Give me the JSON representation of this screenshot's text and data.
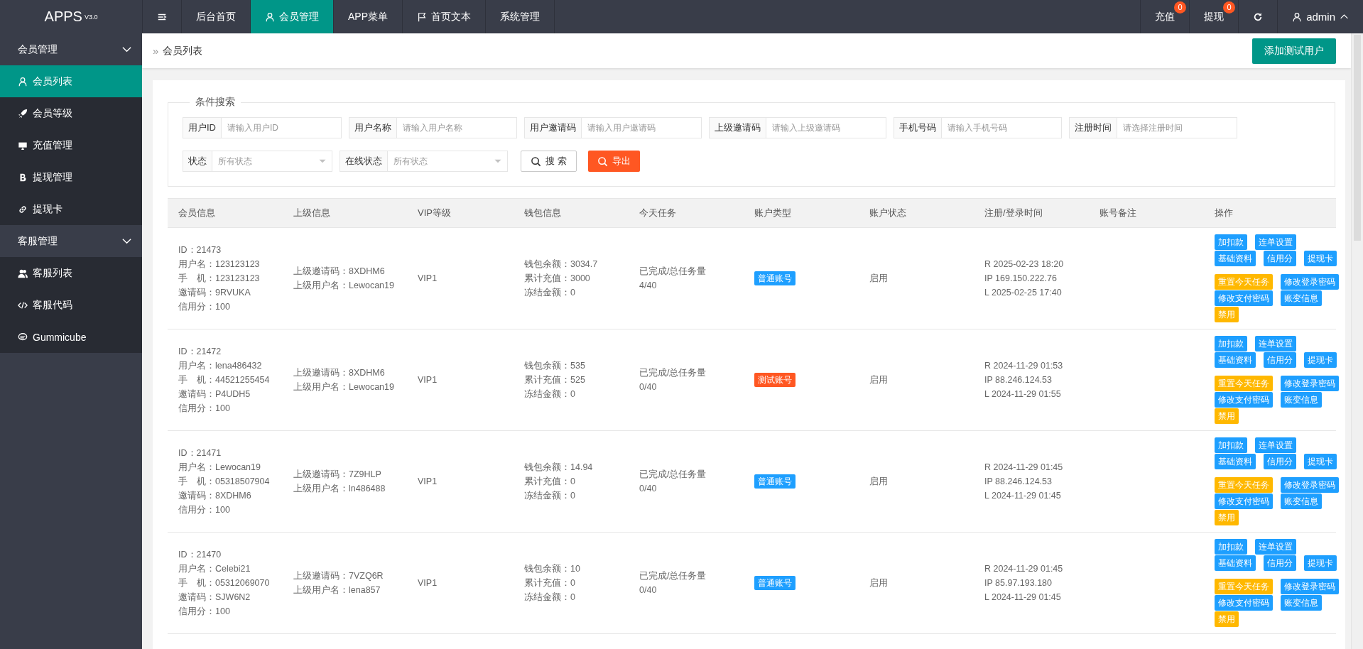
{
  "header": {
    "logo": "APPS$^{V3.0}$",
    "nav": [
      {
        "kind": "menu",
        "selected": false
      },
      {
        "kind": "text",
        "label": "后台首页",
        "selected": false
      },
      {
        "kind": "user",
        "label": "会员管理",
        "selected": true
      },
      {
        "kind": "text",
        "label": "APP菜单",
        "selected": false
      },
      {
        "kind": "flag",
        "label": "首页文本",
        "selected": false
      },
      {
        "kind": "text",
        "label": "系统管理",
        "selected": false
      }
    ],
    "tools": [
      {
        "kind": "text",
        "label": "充值",
        "badge": "0"
      },
      {
        "kind": "text",
        "label": "提现",
        "badge": "0"
      },
      {
        "kind": "refresh"
      },
      {
        "kind": "user",
        "label": "admin"
      }
    ]
  },
  "sidebar": {
    "groups": [
      {
        "label": "会员管理",
        "expanded": true,
        "items": [
          {
            "kind": "user",
            "label": "会员列表",
            "selected": true
          },
          {
            "kind": "rocket",
            "label": "会员等级",
            "selected": false
          },
          {
            "kind": "monitor",
            "label": "充值管理",
            "selected": false
          },
          {
            "kind": "coin",
            "label": "提现管理",
            "selected": false
          },
          {
            "kind": "link",
            "label": "提现卡",
            "selected": false
          }
        ]
      },
      {
        "label": "客服管理",
        "expanded": true,
        "items": [
          {
            "kind": "users",
            "label": "客服列表",
            "selected": false
          },
          {
            "kind": "code",
            "label": "客服代码",
            "selected": false
          },
          {
            "kind": "chat",
            "label": "Gummicube",
            "selected": false
          }
        ]
      }
    ]
  },
  "breadcrumb": {
    "separator": "»",
    "items": [
      "会员列表"
    ]
  },
  "add_button": "添加测试用户",
  "search": {
    "legend": "条件搜索",
    "fields": [
      {
        "kind": "input",
        "label": "用户ID",
        "placeholder": "请输入用户ID"
      },
      {
        "kind": "input",
        "label": "用户名称",
        "placeholder": "请输入用户名称"
      },
      {
        "kind": "input",
        "label": "用户邀请码",
        "placeholder": "请输入用户邀请码"
      },
      {
        "kind": "input",
        "label": "上级邀请码",
        "placeholder": "请输入上级邀请码"
      },
      {
        "kind": "input",
        "label": "手机号码",
        "placeholder": "请输入手机号码"
      },
      {
        "kind": "input",
        "label": "注册时间",
        "placeholder": "请选择注册时间"
      },
      {
        "kind": "select",
        "label": "状态",
        "placeholder": "所有状态"
      },
      {
        "kind": "select",
        "label": "在线状态",
        "placeholder": "所有状态"
      }
    ],
    "buttons": [
      {
        "kind": "plain",
        "label": "搜 索"
      },
      {
        "kind": "danger",
        "label": "导出"
      }
    ]
  },
  "table": {
    "columns": [
      "会员信息",
      "上级信息",
      "VIP等级",
      "钱包信息",
      "今天任务",
      "账户类型",
      "账户状态",
      "注册/登录时间",
      "账号备注",
      "操作"
    ],
    "rows": [
      {
        "member": [
          "ID：21473",
          "用户名：123123123",
          "手　机：123123123",
          "邀请码：9RVUKA",
          "信用分：100"
        ],
        "parent": [
          "上级邀请码：8XDHM6",
          "上级用户名：Lewocan19"
        ],
        "vip": "VIP1",
        "wallet": [
          "钱包余额：3034.7",
          "累计充值：3000",
          "冻结金额：0"
        ],
        "task": [
          "已完成/总任务量",
          "4/40"
        ],
        "account_type": {
          "label": "普通账号",
          "color": "#1e9fff"
        },
        "status": "启用",
        "times": [
          "R 2025-02-23 18:20",
          "IP 169.150.222.76",
          "L 2025-02-25 17:40"
        ],
        "actions": [
          [
            {
              "label": "加扣款",
              "color": "#1e9fff"
            },
            {
              "label": "连单设置",
              "color": "#1e9fff"
            },
            {
              "label": "基础资料",
              "color": "#1e9fff"
            },
            {
              "label": "信用分",
              "color": "#1e9fff"
            },
            {
              "label": "提现卡",
              "color": "#1e9fff"
            }
          ],
          [
            {
              "label": "重置今天任务",
              "color": "#ffb800"
            },
            {
              "label": "修改登录密码",
              "color": "#1e9fff"
            },
            {
              "label": "修改支付密码",
              "color": "#1e9fff"
            },
            {
              "label": "账变信息",
              "color": "#1e9fff"
            },
            {
              "label": "禁用",
              "color": "#ffb800"
            }
          ]
        ]
      },
      {
        "member": [
          "ID：21472",
          "用户名：lena486432",
          "手　机：44521255454",
          "邀请码：P4UDH5",
          "信用分：100"
        ],
        "parent": [
          "上级邀请码：8XDHM6",
          "上级用户名：Lewocan19"
        ],
        "vip": "VIP1",
        "wallet": [
          "钱包余额：535",
          "累计充值：525",
          "冻结金额：0"
        ],
        "task": [
          "已完成/总任务量",
          "0/40"
        ],
        "account_type": {
          "label": "测试账号",
          "color": "#ff5722"
        },
        "status": "启用",
        "times": [
          "R 2024-11-29 01:53",
          "IP 88.246.124.53",
          "L 2024-11-29 01:55"
        ],
        "actions": [
          [
            {
              "label": "加扣款",
              "color": "#1e9fff"
            },
            {
              "label": "连单设置",
              "color": "#1e9fff"
            },
            {
              "label": "基础资料",
              "color": "#1e9fff"
            },
            {
              "label": "信用分",
              "color": "#1e9fff"
            },
            {
              "label": "提现卡",
              "color": "#1e9fff"
            }
          ],
          [
            {
              "label": "重置今天任务",
              "color": "#ffb800"
            },
            {
              "label": "修改登录密码",
              "color": "#1e9fff"
            },
            {
              "label": "修改支付密码",
              "color": "#1e9fff"
            },
            {
              "label": "账变信息",
              "color": "#1e9fff"
            },
            {
              "label": "禁用",
              "color": "#ffb800"
            }
          ]
        ]
      },
      {
        "member": [
          "ID：21471",
          "用户名：Lewocan19",
          "手　机：05318507904",
          "邀请码：8XDHM6",
          "信用分：100"
        ],
        "parent": [
          "上级邀请码：7Z9HLP",
          "上级用户名：ln486488"
        ],
        "vip": "VIP1",
        "wallet": [
          "钱包余额：14.94",
          "累计充值：0",
          "冻结金额：0"
        ],
        "task": [
          "已完成/总任务量",
          "0/40"
        ],
        "account_type": {
          "label": "普通账号",
          "color": "#1e9fff"
        },
        "status": "启用",
        "times": [
          "R 2024-11-29 01:45",
          "IP 88.246.124.53",
          "L 2024-11-29 01:45"
        ],
        "actions": [
          [
            {
              "label": "加扣款",
              "color": "#1e9fff"
            },
            {
              "label": "连单设置",
              "color": "#1e9fff"
            },
            {
              "label": "基础资料",
              "color": "#1e9fff"
            },
            {
              "label": "信用分",
              "color": "#1e9fff"
            },
            {
              "label": "提现卡",
              "color": "#1e9fff"
            }
          ],
          [
            {
              "label": "重置今天任务",
              "color": "#ffb800"
            },
            {
              "label": "修改登录密码",
              "color": "#1e9fff"
            },
            {
              "label": "修改支付密码",
              "color": "#1e9fff"
            },
            {
              "label": "账变信息",
              "color": "#1e9fff"
            },
            {
              "label": "禁用",
              "color": "#ffb800"
            }
          ]
        ]
      },
      {
        "member": [
          "ID：21470",
          "用户名：Celebi21",
          "手　机：05312069070",
          "邀请码：SJW6N2",
          "信用分：100"
        ],
        "parent": [
          "上级邀请码：7VZQ6R",
          "上级用户名：lena857"
        ],
        "vip": "VIP1",
        "wallet": [
          "钱包余额：10",
          "累计充值：0",
          "冻结金额：0"
        ],
        "task": [
          "已完成/总任务量",
          "0/40"
        ],
        "account_type": {
          "label": "普通账号",
          "color": "#1e9fff"
        },
        "status": "启用",
        "times": [
          "R 2024-11-29 01:45",
          "IP 85.97.193.180",
          "L 2024-11-29 01:45"
        ],
        "actions": [
          [
            {
              "label": "加扣款",
              "color": "#1e9fff"
            },
            {
              "label": "连单设置",
              "color": "#1e9fff"
            },
            {
              "label": "基础资料",
              "color": "#1e9fff"
            },
            {
              "label": "信用分",
              "color": "#1e9fff"
            },
            {
              "label": "提现卡",
              "color": "#1e9fff"
            }
          ],
          [
            {
              "label": "重置今天任务",
              "color": "#ffb800"
            },
            {
              "label": "修改登录密码",
              "color": "#1e9fff"
            },
            {
              "label": "修改支付密码",
              "color": "#1e9fff"
            },
            {
              "label": "账变信息",
              "color": "#1e9fff"
            },
            {
              "label": "禁用",
              "color": "#ffb800"
            }
          ]
        ]
      }
    ]
  }
}
